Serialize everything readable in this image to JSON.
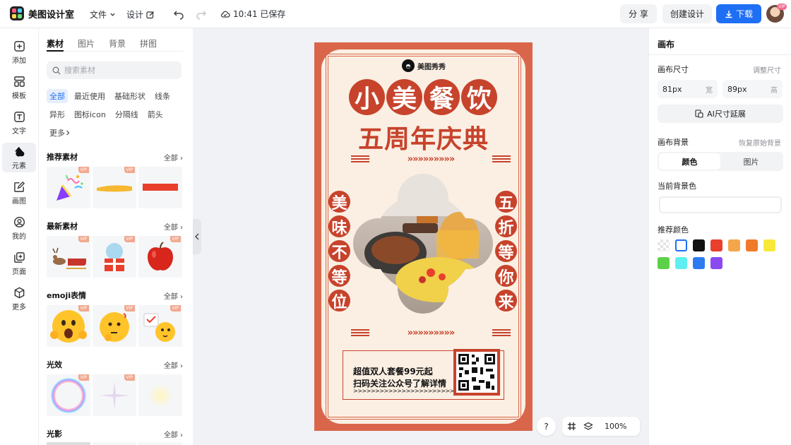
{
  "app": {
    "logo_text": "美图设计室",
    "menu_file": "文件",
    "menu_design": "设计",
    "save_status": "10:41 已保存",
    "share_label": "分 享",
    "create_label": "创建设计",
    "download_label": "下载",
    "avatar_badge": "VIP",
    "accent": "#1f6ff5"
  },
  "rail": {
    "items": [
      {
        "label": "添加",
        "icon": "plus-square-icon"
      },
      {
        "label": "模板",
        "icon": "template-icon"
      },
      {
        "label": "文字",
        "icon": "text-icon"
      },
      {
        "label": "元素",
        "icon": "shapes-icon"
      },
      {
        "label": "画图",
        "icon": "edit-icon"
      },
      {
        "label": "我的",
        "icon": "user-icon"
      },
      {
        "label": "页面",
        "icon": "page-add-icon"
      },
      {
        "label": "更多",
        "icon": "cube-icon"
      }
    ],
    "active": "元素"
  },
  "panel": {
    "tabs": [
      "素材",
      "图片",
      "背景",
      "拼图"
    ],
    "search_placeholder": "搜索素材",
    "chips": [
      "全部",
      "最近使用",
      "基础形状",
      "线条",
      "异形",
      "图标icon",
      "分隔线",
      "箭头",
      "更多"
    ],
    "see_all": "全部",
    "vip": "VIP",
    "sections": [
      {
        "title": "推荐素材"
      },
      {
        "title": "最新素材"
      },
      {
        "title": "emoji表情"
      },
      {
        "title": "光效"
      },
      {
        "title": "光影"
      }
    ]
  },
  "poster": {
    "brand": "美图秀秀",
    "title_chars": [
      "小",
      "美",
      "餐",
      "饮"
    ],
    "subtitle": "五周年庆典",
    "left_chars": [
      "美",
      "味",
      "不",
      "等",
      "位"
    ],
    "right_chars": [
      "五",
      "折",
      "等",
      "你",
      "来"
    ],
    "arrows": "»»»»»»»»»",
    "offer_line1": "超值双人套餐99元起",
    "offer_line2": "扫码关注公众号了解详情",
    "offer_line3": ">>>>>>>>>>>>>>>>>>>>>>>>>>",
    "brand_color": "#c7432c",
    "bg_color": "#fbefe3"
  },
  "canvas_tools": {
    "help": "?",
    "zoom": "100%"
  },
  "right": {
    "title": "画布",
    "size_label": "画布尺寸",
    "size_link": "调整尺寸",
    "width_value": "81px",
    "width_unit": "宽",
    "height_value": "89px",
    "height_unit": "高",
    "ai_extend": "AI尺寸延展",
    "bg_label": "画布背景",
    "bg_reset": "恢复原始背景",
    "seg_color": "颜色",
    "seg_image": "图片",
    "current_bg": "当前背景色",
    "recommended": "推荐颜色",
    "swatches": [
      "transparent",
      "#ffffff",
      "#111111",
      "#e8402c",
      "#f5a64a",
      "#f07a2a",
      "#f7e93a",
      "#5dd04a",
      "#5ef0f0",
      "#2d7bf0",
      "#8a4af0"
    ]
  }
}
